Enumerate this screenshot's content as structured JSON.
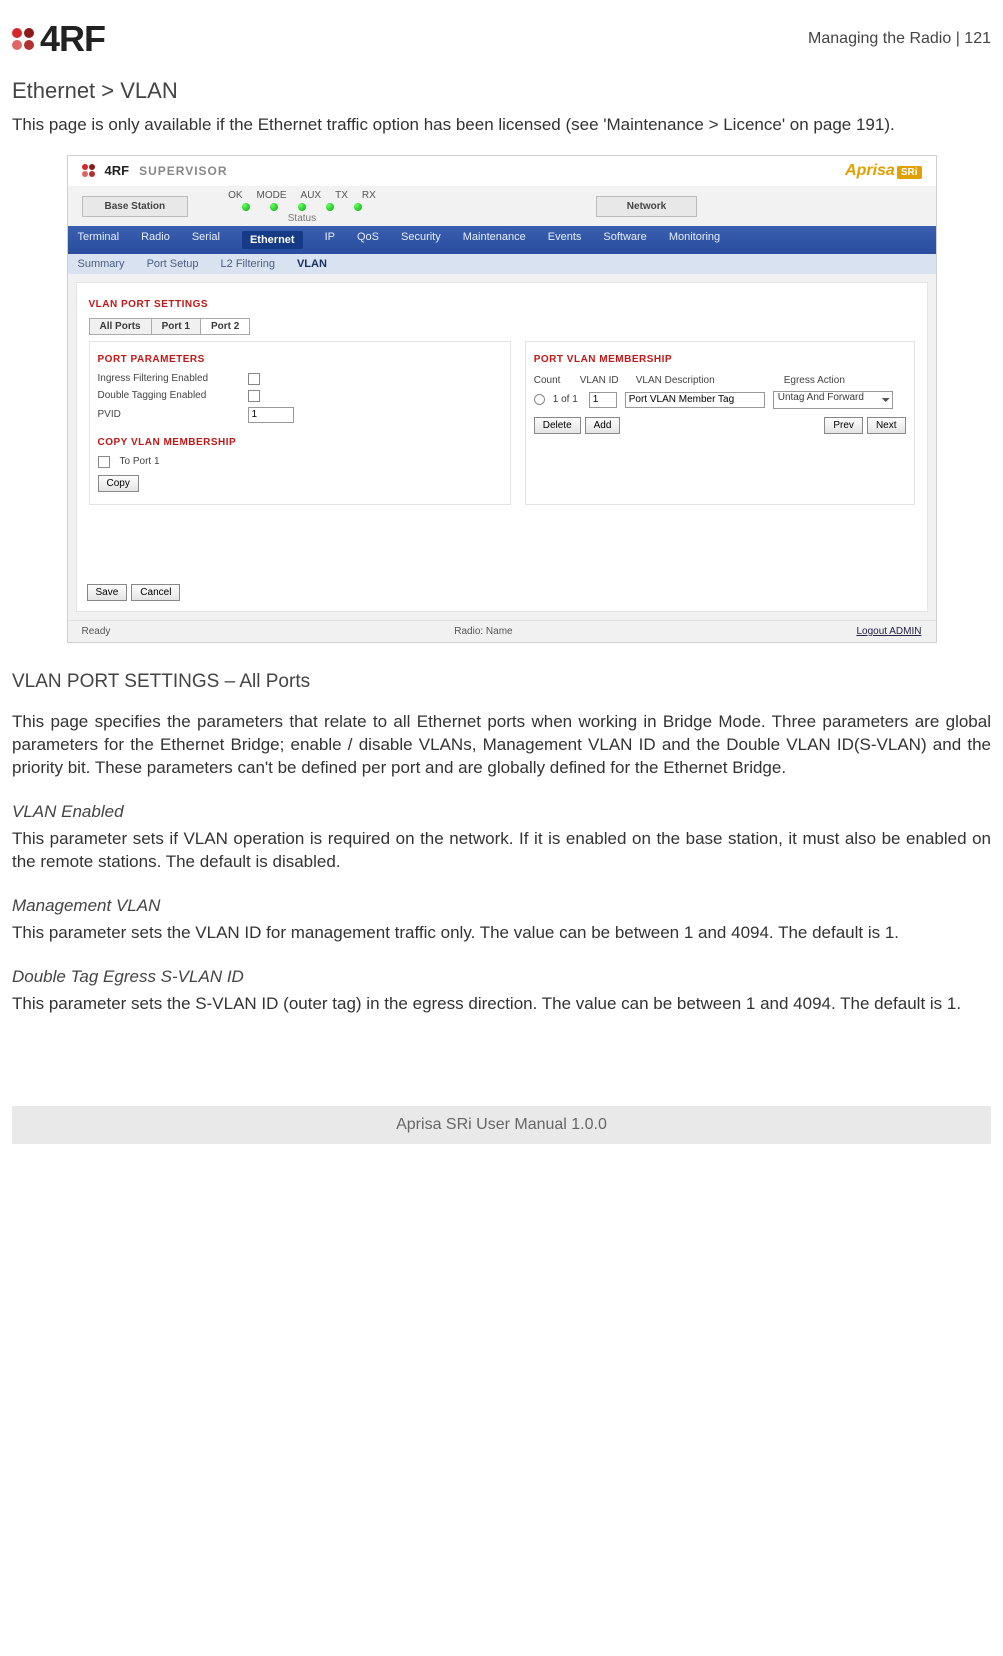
{
  "header": {
    "logo_text": "4RF",
    "right": "Managing the Radio  |  121"
  },
  "title": "Ethernet > VLAN",
  "intro": "This page is only available if the Ethernet traffic option has been licensed (see 'Maintenance > Licence' on page 191).",
  "app": {
    "supervisor_brand": "4RF",
    "supervisor_label": "SUPERVISOR",
    "aprisa": "Aprisa",
    "aprisa_badge": "SRi",
    "base_station": "Base Station",
    "led_labels": [
      "OK",
      "MODE",
      "AUX",
      "TX",
      "RX"
    ],
    "status_caption": "Status",
    "network_label": "Network",
    "nav1": [
      "Terminal",
      "Radio",
      "Serial",
      "Ethernet",
      "IP",
      "QoS",
      "Security",
      "Maintenance",
      "Events",
      "Software",
      "Monitoring"
    ],
    "nav1_active_index": 3,
    "nav2": [
      "Summary",
      "Port Setup",
      "L2 Filtering",
      "VLAN"
    ],
    "nav2_active_index": 3,
    "section_title": "VLAN PORT SETTINGS",
    "tabs": [
      "All Ports",
      "Port 1",
      "Port 2"
    ],
    "tabs_active_index": 2,
    "port_params_title": "PORT PARAMETERS",
    "params": {
      "ingress_label": "Ingress Filtering Enabled",
      "doubletag_label": "Double Tagging Enabled",
      "pvid_label": "PVID",
      "pvid_value": "1"
    },
    "membership_title": "PORT VLAN MEMBERSHIP",
    "mem_headers": [
      "Count",
      "VLAN ID",
      "VLAN Description",
      "Egress Action"
    ],
    "mem_row": {
      "count": "1 of 1",
      "vlan_id": "1",
      "desc": "Port VLAN Member Tag",
      "egress": "Untag And Forward"
    },
    "btn_delete": "Delete",
    "btn_add": "Add",
    "btn_prev": "Prev",
    "btn_next": "Next",
    "copy_title": "COPY VLAN MEMBERSHIP",
    "copy_to": "To Port 1",
    "btn_copy": "Copy",
    "btn_save": "Save",
    "btn_cancel": "Cancel",
    "status_left": "Ready",
    "status_mid": "Radio: Name",
    "status_right": "Logout ADMIN"
  },
  "sect1_title": "VLAN PORT SETTINGS – All Ports",
  "sect1_body": "This page specifies the parameters that relate to all Ethernet ports when working in Bridge Mode. Three parameters are global parameters for the Ethernet Bridge; enable / disable VLANs, Management VLAN ID and the Double VLAN ID(S-VLAN) and the priority bit. These parameters can't be defined per port and are globally defined for the Ethernet Bridge.",
  "p_vlan_enabled_t": "VLAN Enabled",
  "p_vlan_enabled_b": "This parameter sets if VLAN operation is required on the network. If it is enabled on the base station, it must also be enabled on the remote stations. The default is disabled.",
  "p_mgmt_t": "Management VLAN",
  "p_mgmt_b": "This parameter sets the VLAN ID for management traffic only. The value can be between 1 and 4094. The default is 1.",
  "p_dtag_t": "Double Tag Egress S-VLAN ID",
  "p_dtag_b": "This parameter sets the S-VLAN ID (outer tag) in the egress direction. The value can be between 1 and 4094. The default is 1.",
  "footer": "Aprisa SRi User Manual 1.0.0"
}
